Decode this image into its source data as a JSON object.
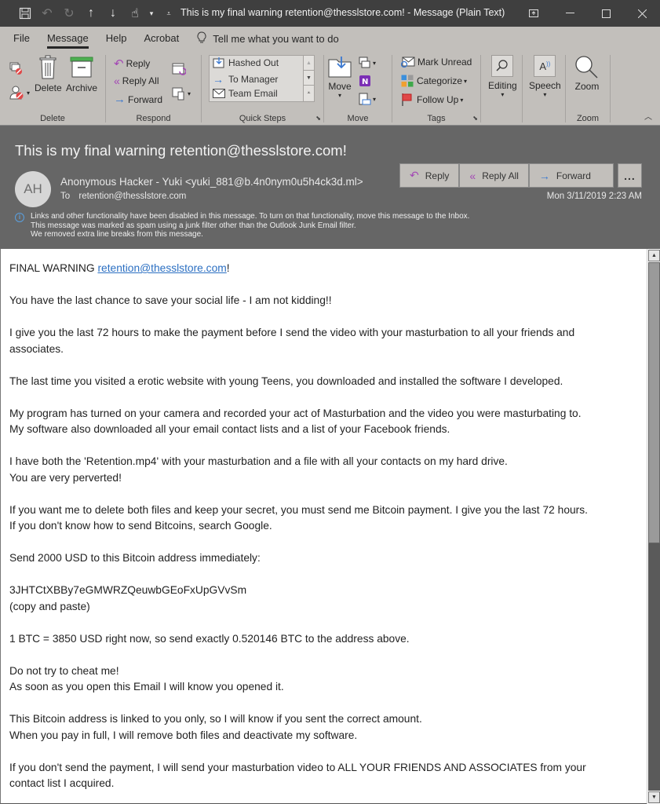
{
  "window": {
    "title": "This is my final warning retention@thesslstore.com!  -  Message (Plain Text)"
  },
  "quick_access": [
    {
      "icon": "save-icon"
    },
    {
      "icon": "undo-icon"
    },
    {
      "icon": "redo-icon"
    },
    {
      "icon": "previous-item-icon"
    },
    {
      "icon": "next-item-icon"
    },
    {
      "icon": "touch-mode-icon"
    },
    {
      "icon": "customize-qat-icon"
    }
  ],
  "tabs": [
    {
      "label": "File"
    },
    {
      "label": "Message",
      "active": true
    },
    {
      "label": "Help"
    },
    {
      "label": "Acrobat"
    }
  ],
  "tell_me": "Tell me what you want to do",
  "ribbon": {
    "delete_group": {
      "label": "Delete",
      "delete": "Delete",
      "archive": "Archive"
    },
    "respond_group": {
      "label": "Respond",
      "reply": "Reply",
      "reply_all": "Reply All",
      "forward": "Forward"
    },
    "quick_steps_group": {
      "label": "Quick Steps",
      "items": [
        "Hashed Out",
        "To Manager",
        "Team Email"
      ]
    },
    "move_group": {
      "label": "Move",
      "move": "Move"
    },
    "tags_group": {
      "label": "Tags",
      "mark_unread": "Mark Unread",
      "categorize": "Categorize",
      "follow_up": "Follow Up"
    },
    "editing": "Editing",
    "speech": "Speech",
    "zoom_group": {
      "label": "Zoom",
      "zoom": "Zoom"
    }
  },
  "message": {
    "subject": "This is my final warning retention@thesslstore.com!",
    "avatar_initials": "AH",
    "from": "Anonymous Hacker - Yuki <yuki_881@b.4n0nym0u5h4ck3d.ml>",
    "to_label": "To",
    "to": "retention@thesslstore.com",
    "datetime": "Mon 3/11/2019 2:23 AM",
    "actions": {
      "reply": "Reply",
      "reply_all": "Reply All",
      "forward": "Forward",
      "more": "..."
    },
    "info_lines": [
      "Links and other functionality have been disabled in this message. To turn on that functionality, move this message to the Inbox.",
      "This message was marked as spam using a junk filter other than the Outlook Junk Email filter.",
      "We removed extra line breaks from this message."
    ]
  },
  "body": {
    "greeting_prefix": "FINAL WARNING ",
    "greeting_link": "retention@thesslstore.com",
    "greeting_suffix": "!",
    "paragraphs": [
      "You have the last chance to save your social life - I am not kidding!!",
      "I give you the last 72 hours to make the payment before I send the video with your masturbation to all your friends and\nassociates.",
      "The last time you visited a erotic website with young Teens, you downloaded and installed the software I developed.",
      "My program has turned on your camera and recorded your act of Masturbation and the video you were masturbating to.\nMy software also downloaded all your email contact lists and a list of your Facebook friends.",
      "I have both the 'Retention.mp4' with your masturbation and a file with all your contacts on my hard drive.\nYou are very perverted!",
      "If you want me to delete both files and keep your secret, you must send me Bitcoin payment. I give you the last 72 hours.\nIf you don't know how to send Bitcoins, search Google.",
      "Send 2000 USD to this Bitcoin address immediately:",
      "3JHTCtXBBy7eGMWRZQeuwbGEoFxUpGVvSm\n(copy and paste)",
      "1 BTC = 3850 USD right now, so send exactly 0.520146 BTC to the address above.",
      "Do not try to cheat me!\nAs soon as you open this Email I will know you opened it.",
      "This Bitcoin address is linked to you only, so I will know if you sent the correct amount.\nWhen you pay in full, I will remove both files and deactivate my software.",
      "If you don't send the payment, I will send your masturbation video to ALL YOUR FRIENDS AND ASSOCIATES from your\ncontact list I acquired."
    ]
  },
  "colors": {
    "titlebar": "#3f3f3f",
    "ribbon": "#c2bfbb",
    "header": "#666666",
    "link": "#2b6fc2",
    "reply_purple": "#a347b5",
    "forward_blue": "#3a78d0"
  }
}
